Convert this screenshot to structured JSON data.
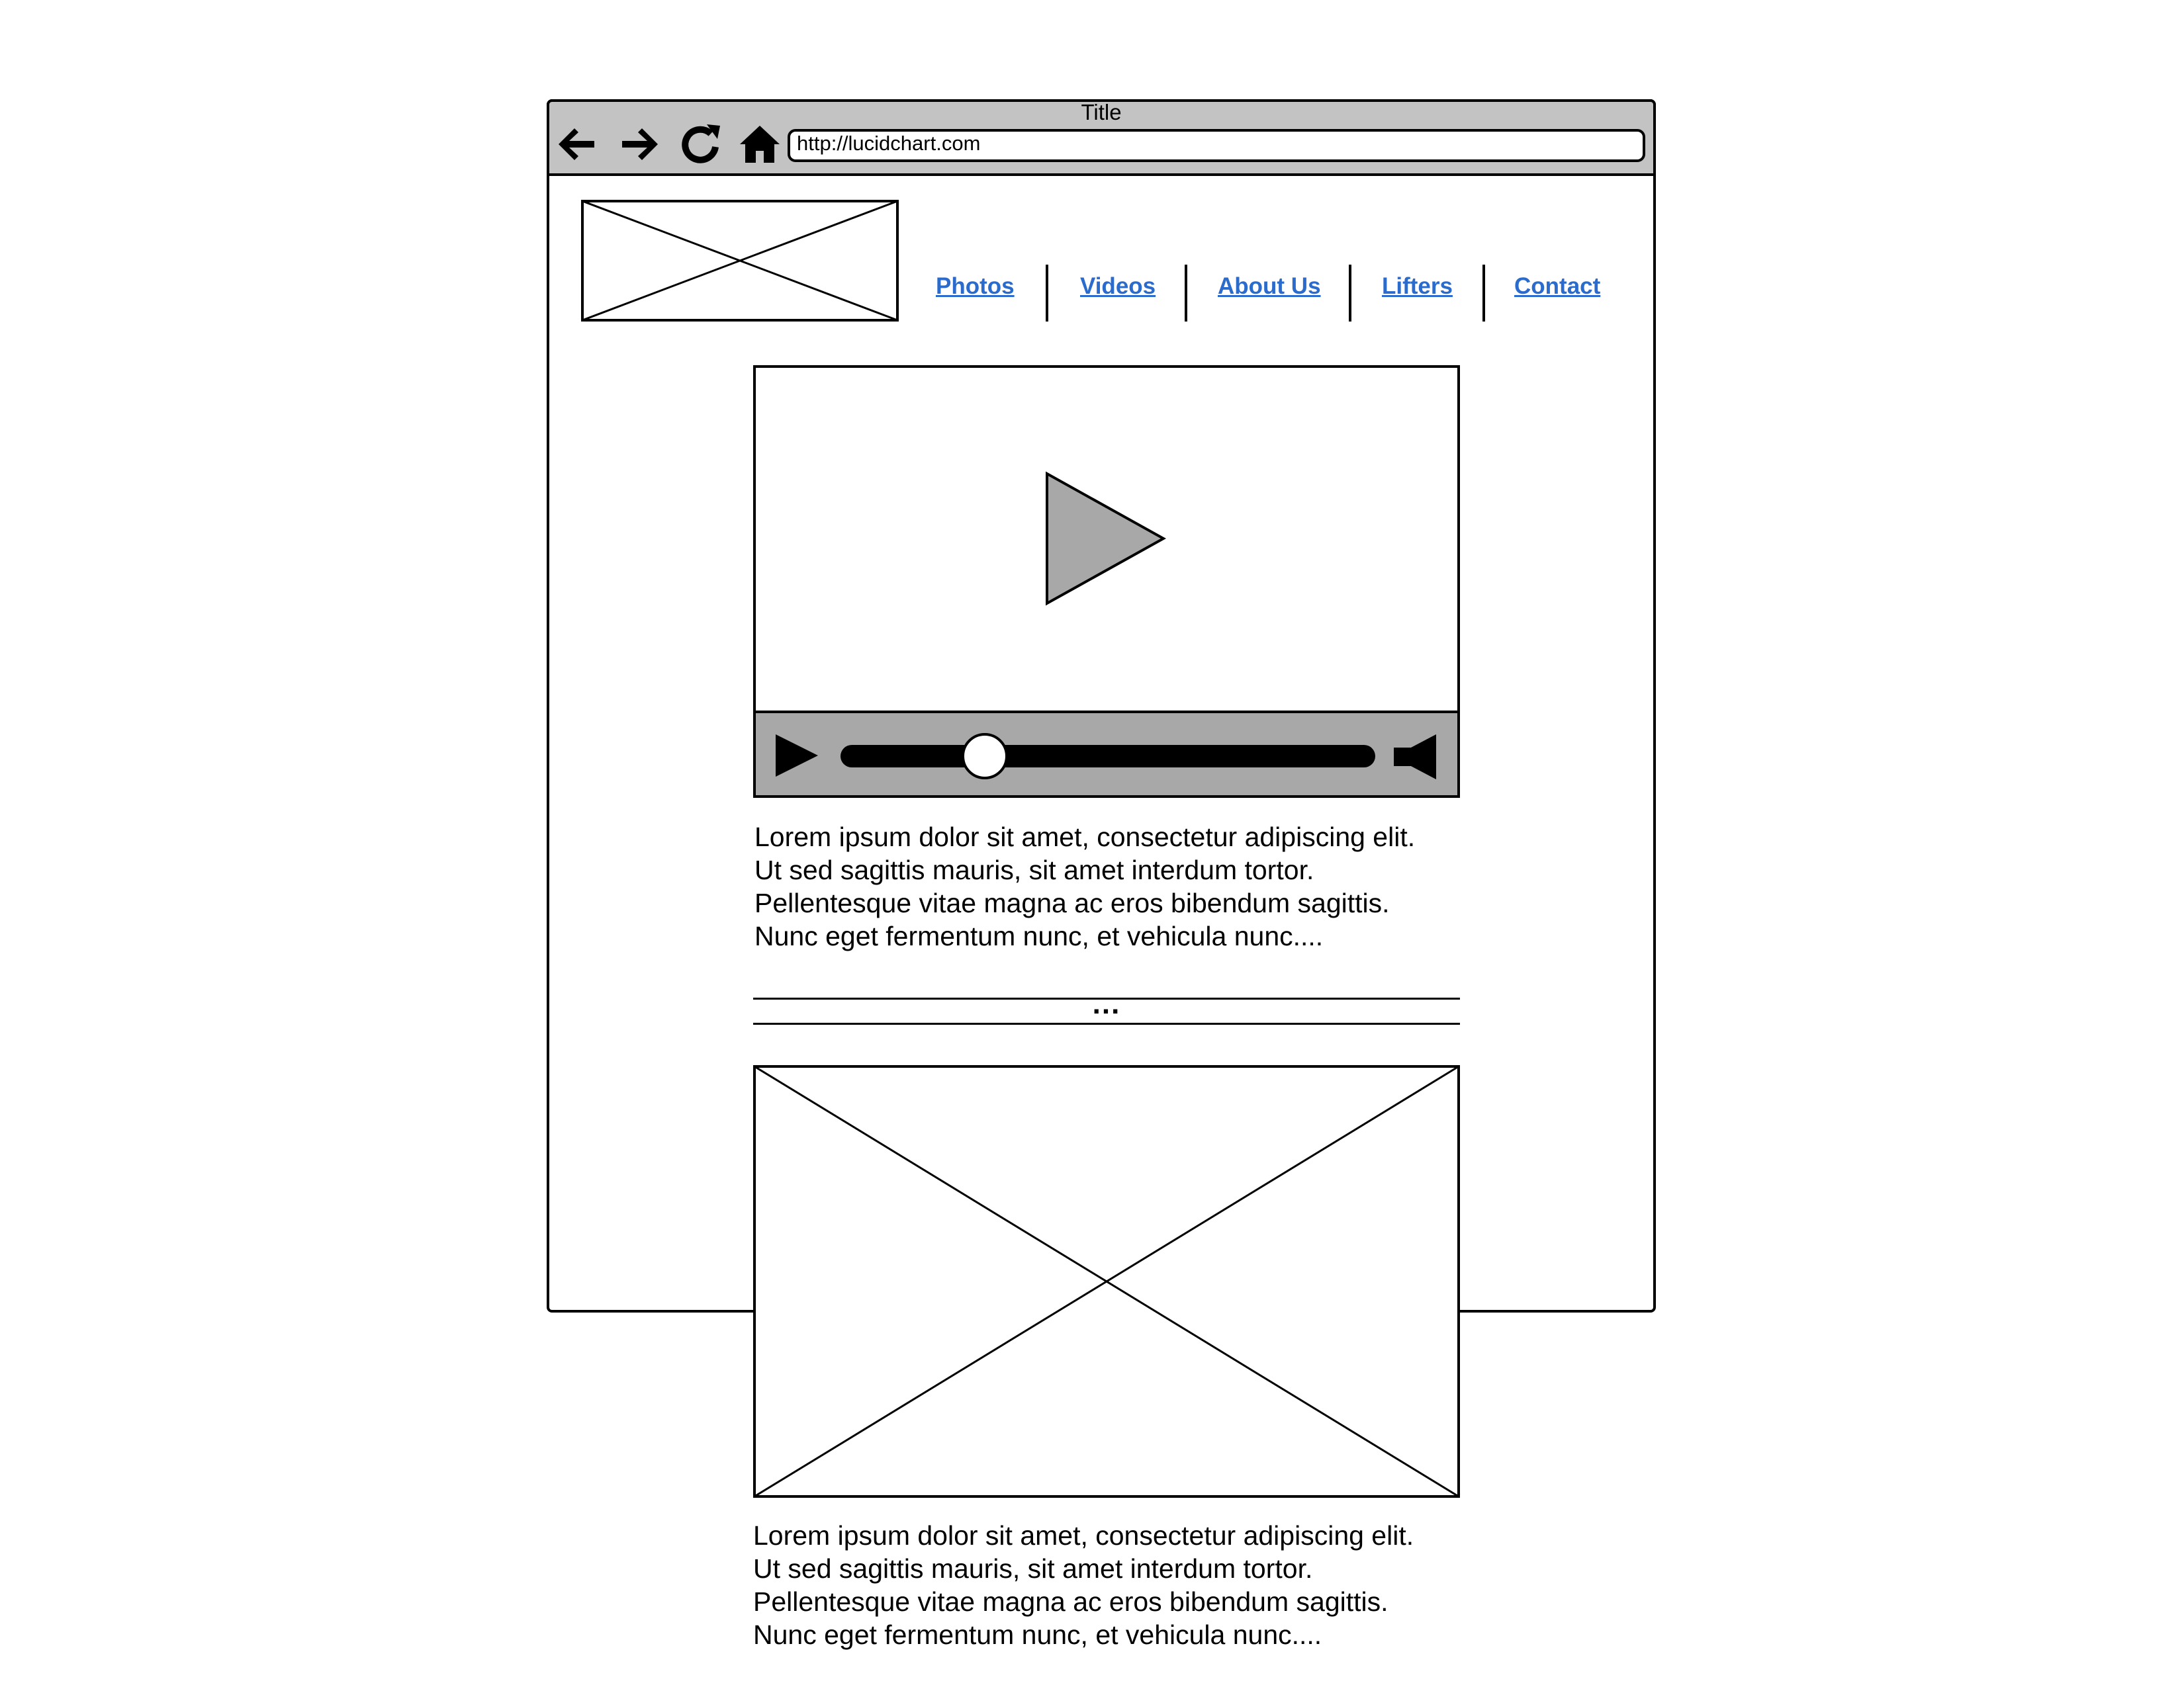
{
  "window": {
    "title": "Title"
  },
  "toolbar": {
    "back_icon": "arrow-left-icon",
    "forward_icon": "arrow-right-icon",
    "reload_icon": "reload-icon",
    "home_icon": "home-icon",
    "url": "http://lucidchart.com"
  },
  "nav": {
    "links": [
      {
        "label": "Photos"
      },
      {
        "label": "Videos"
      },
      {
        "label": "About Us"
      },
      {
        "label": "Lifters"
      },
      {
        "label": "Contact"
      }
    ],
    "link_color": "#2a6bcc"
  },
  "video": {
    "progress": 0.27,
    "controls_bg": "#a8a8a8"
  },
  "content": {
    "paragraph_1": [
      "Lorem ipsum dolor sit amet, consectetur adipiscing elit.",
      "Ut sed sagittis mauris, sit amet interdum tortor.",
      "Pellentesque vitae magna ac eros bibendum sagittis.",
      "Nunc eget fermentum nunc, et vehicula nunc...."
    ],
    "divider_text": "...",
    "paragraph_2": [
      "Lorem ipsum dolor sit amet, consectetur adipiscing elit.",
      "Ut sed sagittis mauris, sit amet interdum tortor.",
      "Pellentesque vitae magna ac eros bibendum sagittis.",
      "Nunc eget fermentum nunc, et vehicula nunc...."
    ]
  }
}
